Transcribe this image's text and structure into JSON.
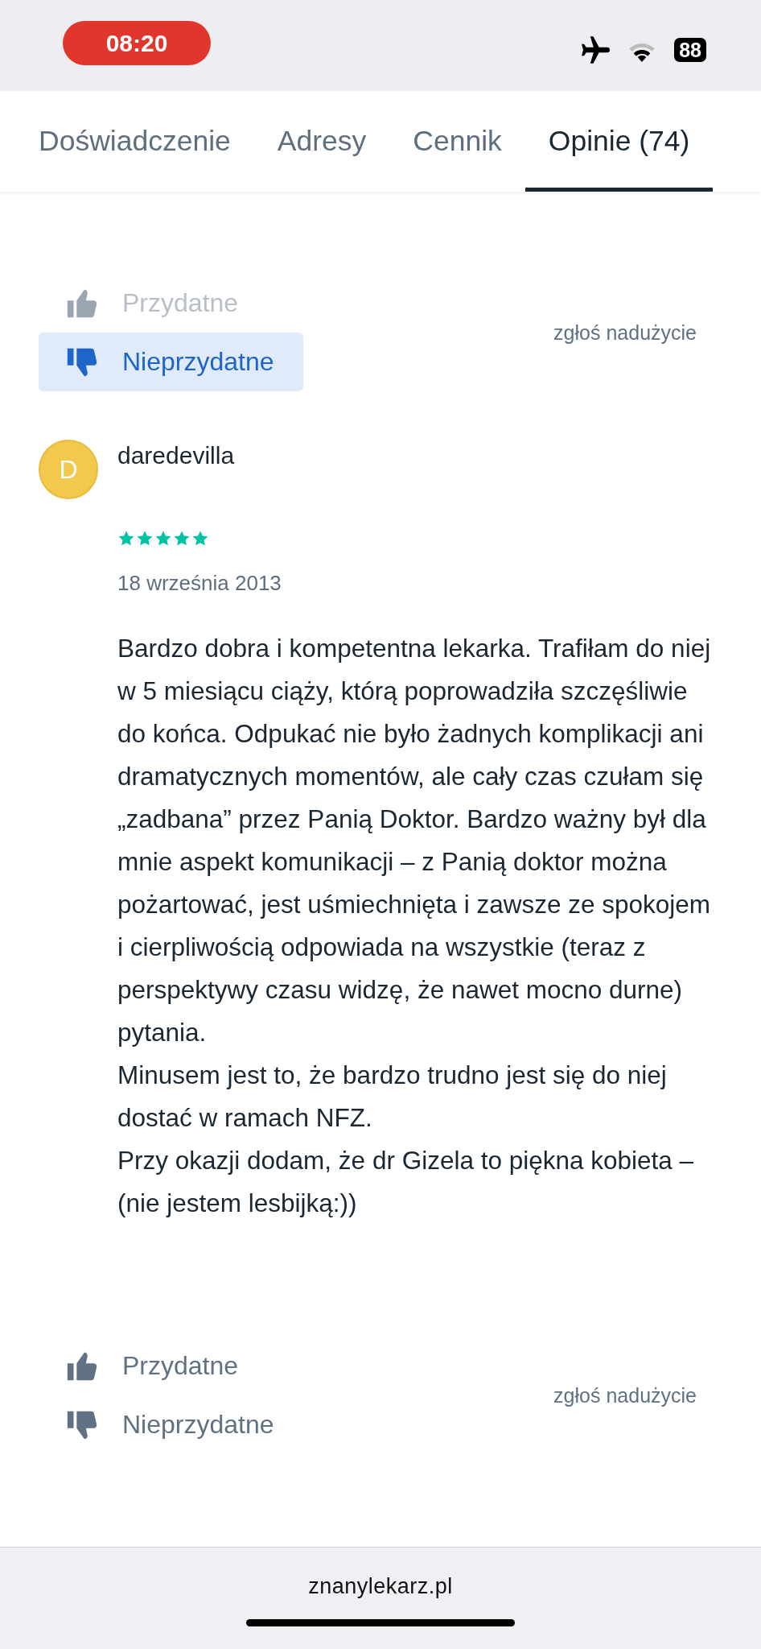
{
  "status_bar": {
    "time": "08:20",
    "battery": "88"
  },
  "tabs": [
    {
      "label": "Doświadczenie",
      "selected": false
    },
    {
      "label": "Adresy",
      "selected": false
    },
    {
      "label": "Cennik",
      "selected": false
    },
    {
      "label": "Opinie (74)",
      "selected": true
    }
  ],
  "previous_review": {
    "votes": [
      {
        "kind": "helpful",
        "label": "Przydatne",
        "selected": false,
        "disabled": true
      },
      {
        "kind": "unhelpful",
        "label": "Nieprzydatne",
        "selected": true,
        "disabled": false
      }
    ],
    "report": "zgłoś nadużycie"
  },
  "review": {
    "avatar": "D",
    "author": "daredevilla",
    "stars": 5,
    "date": "18 września 2013",
    "paragraphs": [
      "Bardzo dobra i kompetentna lekarka. Trafiłam do niej w 5 miesiącu ciąży, którą poprowadziła szczęśliwie do końca. Odpukać nie było żadnych komplikacji ani dramatycznych momentów, ale cały czas czułam się „zadbana” przez Panią Doktor. Bardzo ważny był dla mnie aspekt komunikacji – z Panią doktor można pożartować, jest uśmiechnięta i zawsze ze spokojem i cierpliwością odpowiada na wszystkie (teraz z perspektywy czasu widzę, że nawet mocno durne) pytania.",
      "Minusem jest to, że bardzo trudno jest się do niej dostać w ramach NFZ.",
      "Przy okazji dodam, że dr Gizela to piękna kobieta – (nie jestem lesbijką:))"
    ],
    "votes": [
      {
        "kind": "helpful",
        "label": "Przydatne",
        "selected": false,
        "disabled": false
      },
      {
        "kind": "unhelpful",
        "label": "Nieprzydatne",
        "selected": false,
        "disabled": false
      }
    ],
    "report": "zgłoś nadużycie"
  },
  "address_bar": {
    "url": "znanylekarz.pl"
  }
}
